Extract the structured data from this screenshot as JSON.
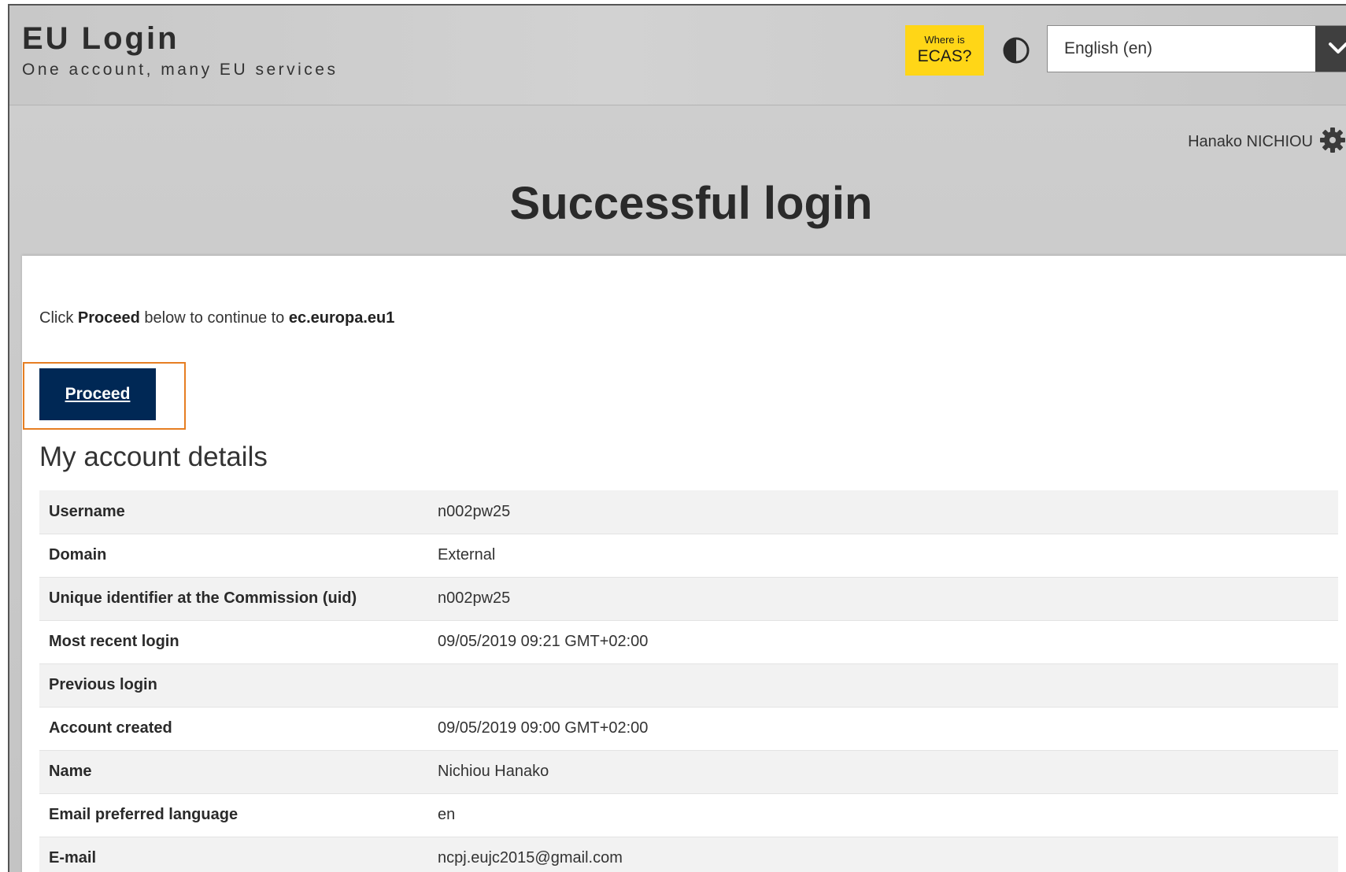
{
  "header": {
    "brand_title": "EU Login",
    "brand_subtitle": "One account, many EU services",
    "ecas_small": "Where is",
    "ecas_big": "ECAS?",
    "language_selected": "English (en)",
    "user_name": "Hanako NICHIOU"
  },
  "page": {
    "title": "Successful login"
  },
  "intro": {
    "prefix": "Click",
    "proceed_word": "Proceed",
    "middle": "below to continue to",
    "destination": "ec.europa.eu1"
  },
  "actions": {
    "proceed_label": "Proceed"
  },
  "account": {
    "section_title": "My account details",
    "rows": [
      {
        "key": "Username",
        "value": "n002pw25"
      },
      {
        "key": "Domain",
        "value": "External"
      },
      {
        "key": "Unique identifier at the Commission (uid)",
        "value": "n002pw25"
      },
      {
        "key": "Most recent login",
        "value": "09/05/2019 09:21 GMT+02:00"
      },
      {
        "key": "Previous login",
        "value": ""
      },
      {
        "key": "Account created",
        "value": "09/05/2019 09:00 GMT+02:00"
      },
      {
        "key": "Name",
        "value": "Nichiou Hanako"
      },
      {
        "key": "Email preferred language",
        "value": "en"
      },
      {
        "key": "E-mail",
        "value": "ncpj.eujc2015@gmail.com"
      }
    ]
  },
  "colors": {
    "accent_yellow": "#ffd617",
    "primary_button": "#002855",
    "highlight_outline": "#e67e22"
  },
  "icons": {
    "contrast": "contrast-icon",
    "dropdown": "chevron-down-icon",
    "settings": "gear-icon"
  }
}
